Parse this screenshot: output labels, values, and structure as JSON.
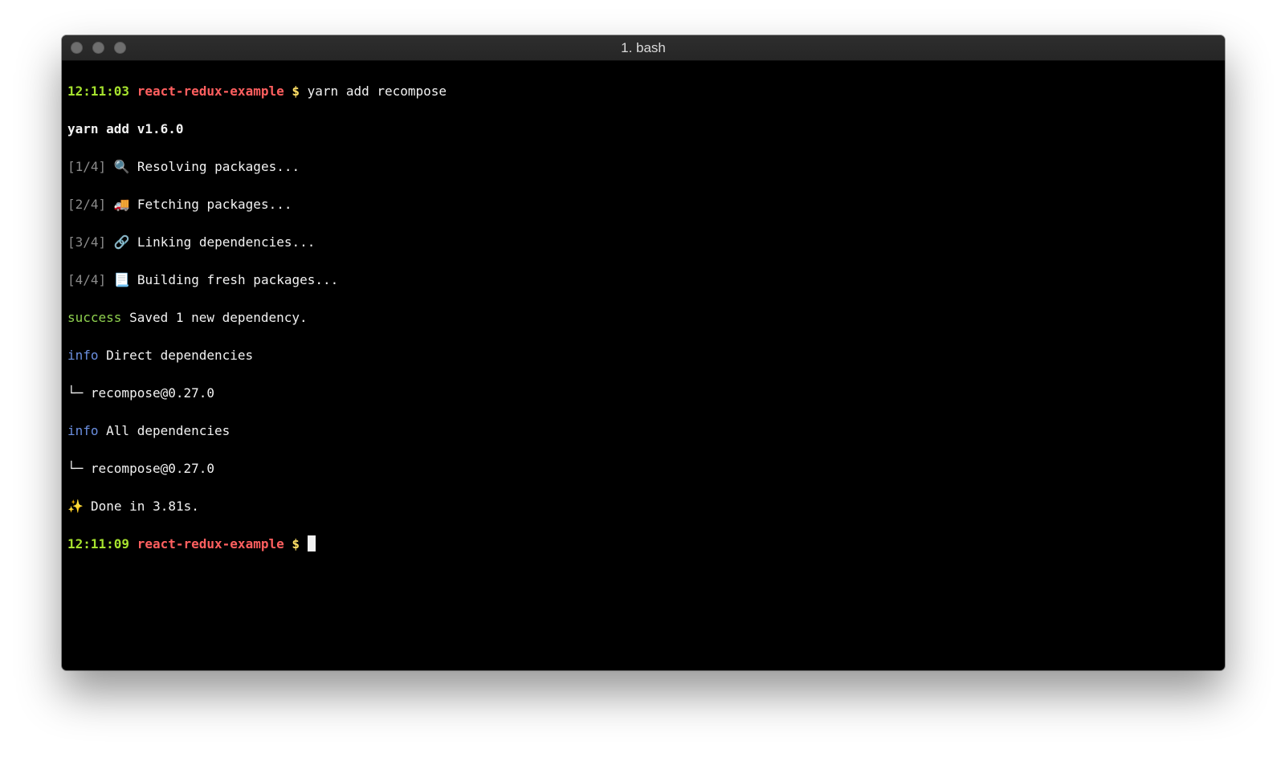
{
  "window": {
    "title": "1. bash",
    "traffic_light_color": "#6e6e6e",
    "background": "#000000"
  },
  "terminal": {
    "prompt1": {
      "time": "12:11:03",
      "dir": "react-redux-example",
      "symbol": "$",
      "command": " yarn add recompose"
    },
    "version_line": "yarn add v1.6.0",
    "steps": [
      {
        "label": "[1/4]",
        "icon": "🔍",
        "icon_name": "magnifier-icon",
        "text": "Resolving packages..."
      },
      {
        "label": "[2/4]",
        "icon": "🚚",
        "icon_name": "truck-icon",
        "text": "Fetching packages..."
      },
      {
        "label": "[3/4]",
        "icon": "🔗",
        "icon_name": "link-icon",
        "text": "Linking dependencies..."
      },
      {
        "label": "[4/4]",
        "icon": "📃",
        "icon_name": "page-icon",
        "text": "Building fresh packages..."
      }
    ],
    "success": {
      "tag": "success",
      "text": " Saved 1 new dependency."
    },
    "info_direct": {
      "tag": "info",
      "text": " Direct dependencies"
    },
    "tree_direct": "└─ recompose@0.27.0",
    "info_all": {
      "tag": "info",
      "text": " All dependencies"
    },
    "tree_all": "└─ recompose@0.27.0",
    "done": {
      "icon": "✨",
      "icon_name": "sparkles-icon",
      "text": "Done in 3.81s."
    },
    "prompt2": {
      "time": "12:11:09",
      "dir": "react-redux-example",
      "symbol": "$"
    }
  },
  "colors": {
    "time": "#a6e22e",
    "dir": "#ff5f5f",
    "dollar": "#ffe066",
    "success": "#8fd14f",
    "info": "#6b8fe0",
    "step": "#8c8c8c"
  }
}
